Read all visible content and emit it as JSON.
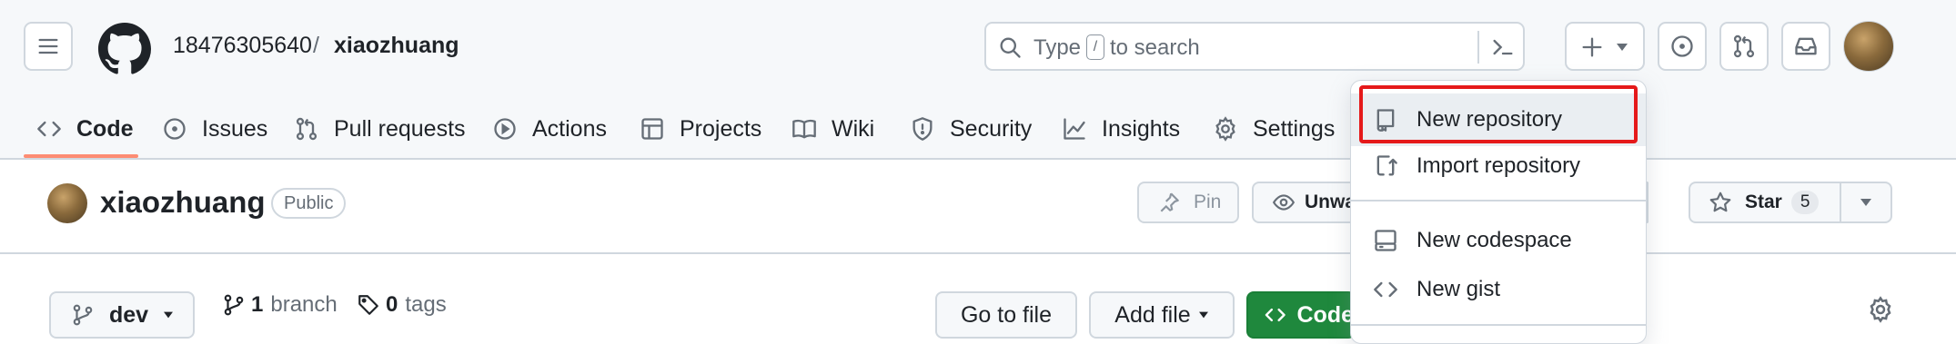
{
  "header": {
    "owner": "18476305640",
    "separator": "/",
    "repo": "xiaozhuang",
    "search": {
      "placeholder_before": "Type",
      "key": "/",
      "placeholder_after": "to search"
    }
  },
  "nav": {
    "tabs": [
      {
        "label": "Code",
        "icon": "code-icon"
      },
      {
        "label": "Issues",
        "icon": "issue-icon"
      },
      {
        "label": "Pull requests",
        "icon": "pull-request-icon"
      },
      {
        "label": "Actions",
        "icon": "play-icon"
      },
      {
        "label": "Projects",
        "icon": "table-icon"
      },
      {
        "label": "Wiki",
        "icon": "book-icon"
      },
      {
        "label": "Security",
        "icon": "shield-icon"
      },
      {
        "label": "Insights",
        "icon": "graph-icon"
      },
      {
        "label": "Settings",
        "icon": "gear-icon"
      }
    ]
  },
  "repo_header": {
    "name": "xiaozhuang",
    "visibility": "Public",
    "pin_label": "Pin",
    "watch_label": "Unwa",
    "star_label": "Star",
    "star_count": "5"
  },
  "toolbar": {
    "branch": "dev",
    "branch_count": "1",
    "branch_word": "branch",
    "tag_count": "0",
    "tag_word": "tags",
    "goto_file": "Go to file",
    "add_file": "Add file",
    "code": "Code"
  },
  "create_menu": {
    "items": [
      {
        "label": "New repository",
        "icon": "repo-icon"
      },
      {
        "label": "Import repository",
        "icon": "repo-push-icon"
      },
      {
        "label": "New codespace",
        "icon": "codespace-icon"
      },
      {
        "label": "New gist",
        "icon": "code-icon"
      }
    ],
    "highlight_color": "#e5191a"
  },
  "colors": {
    "accent_underline": "#fd8c73",
    "primary_button": "#1f883d"
  }
}
